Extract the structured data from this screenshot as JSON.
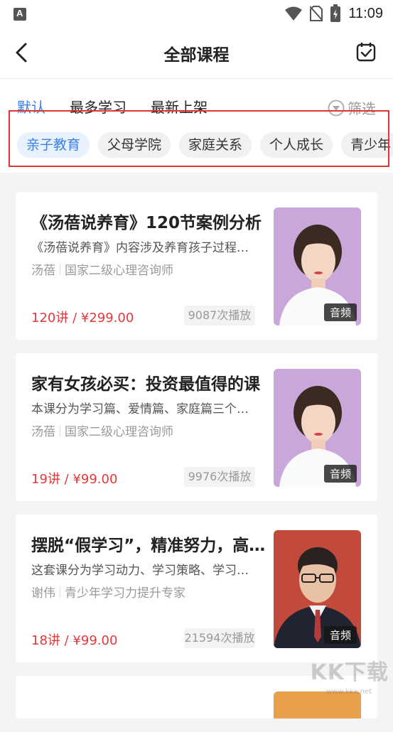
{
  "status_bar": {
    "time": "11:09"
  },
  "header": {
    "title": "全部课程"
  },
  "sort_tabs": [
    {
      "label": "默认",
      "active": true
    },
    {
      "label": "最多学习",
      "active": false
    },
    {
      "label": "最新上架",
      "active": false
    }
  ],
  "filter": {
    "label": "筛选"
  },
  "categories": [
    {
      "label": "亲子教育",
      "active": true
    },
    {
      "label": "父母学院",
      "active": false
    },
    {
      "label": "家庭关系",
      "active": false
    },
    {
      "label": "个人成长",
      "active": false
    },
    {
      "label": "青少年",
      "active": false
    }
  ],
  "courses": [
    {
      "title": "《汤蓓说养育》120节案例分析",
      "desc": "《汤蓓说养育》内容涉及养育孩子过程中的方方面面",
      "author": "汤蓓",
      "author_title": "国家二级心理咨询师",
      "price": "120讲 / ¥299.00",
      "plays": "9087次播放",
      "badge": "音频"
    },
    {
      "title": "家有女孩必买：投资最值得的课",
      "desc": "本课分为学习篇、爱情篇、家庭篇三个部分",
      "author": "汤蓓",
      "author_title": "国家二级心理咨询师",
      "price": "19讲 / ¥99.00",
      "plays": "9976次播放",
      "badge": "音频"
    },
    {
      "title": "摆脱“假学习”，精准努力，高效学习",
      "desc": "这套课分为学习动力、学习策略、学习习惯",
      "author": "谢伟",
      "author_title": "青少年学习力提升专家",
      "price": "18讲 / ¥99.00",
      "plays": "21594次播放",
      "badge": "音频"
    }
  ],
  "partial_course": {
    "title": ""
  },
  "watermark": {
    "text": "KK下载",
    "sub": "www.kkx.net"
  },
  "colors": {
    "accent": "#3b7fe6",
    "price": "#e23a3a",
    "highlight_box": "#e03535"
  }
}
